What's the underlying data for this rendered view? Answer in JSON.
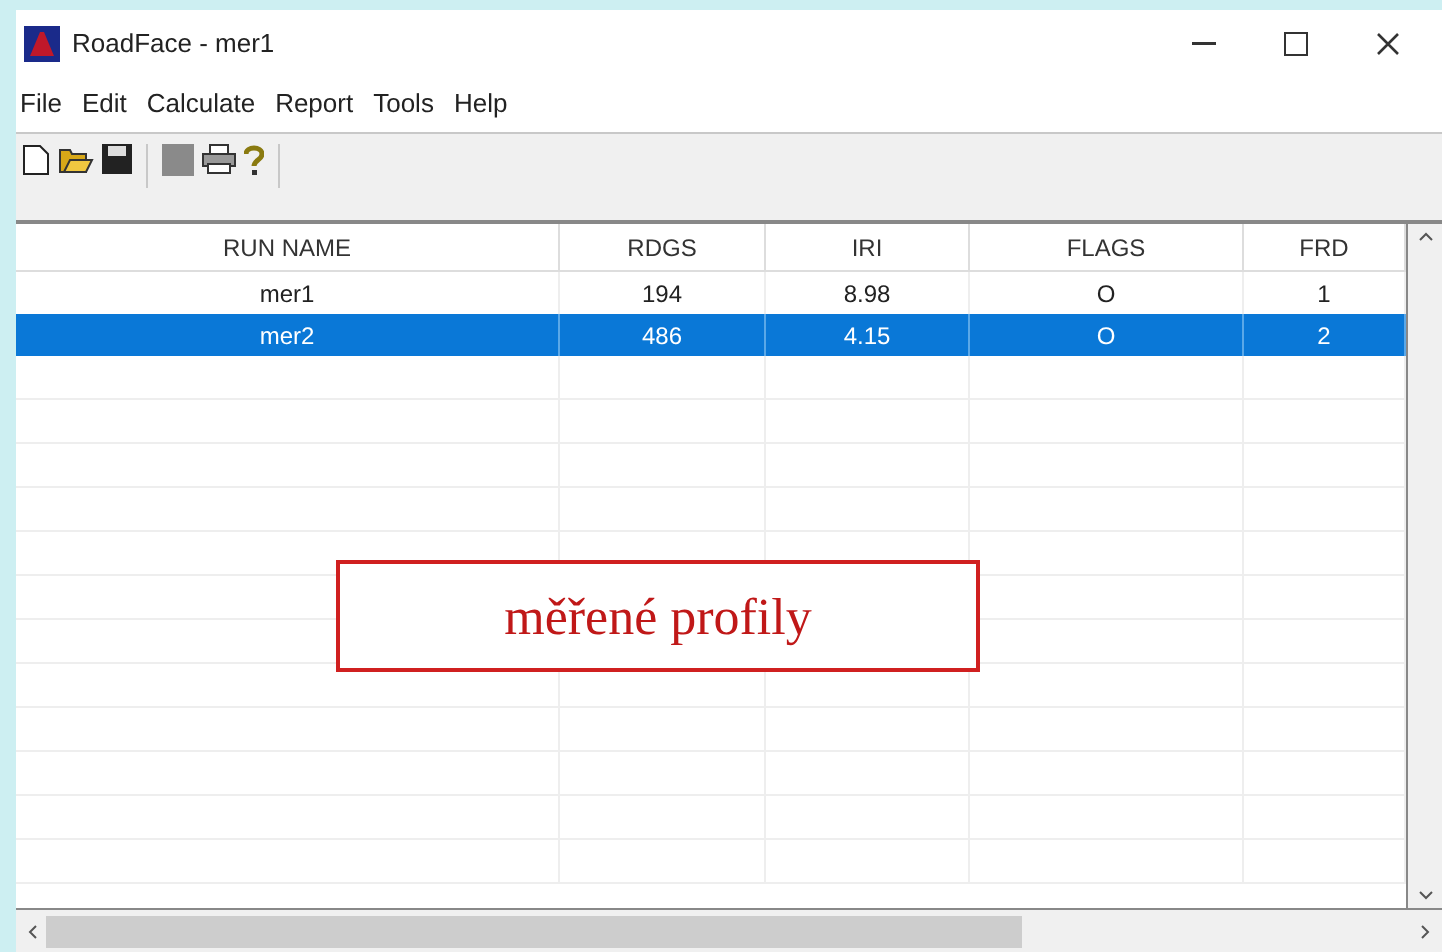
{
  "window": {
    "title": "RoadFace - mer1"
  },
  "menu": [
    "File",
    "Edit",
    "Calculate",
    "Report",
    "Tools",
    "Help"
  ],
  "table": {
    "columns": [
      "RUN NAME",
      "RDGS",
      "IRI",
      "FLAGS",
      "FRD"
    ],
    "rows": [
      {
        "cells": [
          "mer1",
          "194",
          "8.98",
          "O",
          "1"
        ],
        "selected": false
      },
      {
        "cells": [
          "mer2",
          "486",
          "4.15",
          "O",
          "2"
        ],
        "selected": true
      }
    ]
  },
  "annotation": "měřené profily"
}
